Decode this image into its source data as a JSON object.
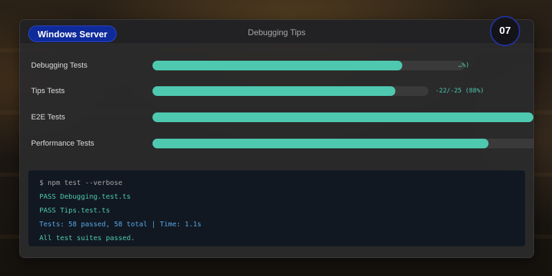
{
  "os_badge": "Windows Server",
  "window_title": "Debugging Tips",
  "step_number": "07",
  "colors": {
    "badge_bg": "#0f2a9a",
    "bar_fill": "#4ec9b0",
    "prompt": "#a6a6a6",
    "pass": "#4ec9b0",
    "summary": "#56a8e6"
  },
  "tests": [
    {
      "label": "Debugging Tests",
      "progress": 0.8,
      "stat": "…%)"
    },
    {
      "label": "Tips Tests",
      "progress": 0.88,
      "stat": "-22/-25 (88%)"
    },
    {
      "label": "E2E Tests",
      "progress": 1.0,
      "stat": ""
    },
    {
      "label": "Performance Tests",
      "progress": 0.87,
      "stat": ""
    }
  ],
  "terminal": {
    "lines": [
      {
        "text": "$ npm test --verbose",
        "kind": "prompt"
      },
      {
        "text": "PASS Debugging.test.ts",
        "kind": "pass"
      },
      {
        "text": "PASS Tips.test.ts",
        "kind": "pass"
      },
      {
        "text": "Tests: 58 passed, 58 total | Time: 1.1s",
        "kind": "summary"
      },
      {
        "text": "All test suites passed.",
        "kind": "pass"
      }
    ]
  }
}
